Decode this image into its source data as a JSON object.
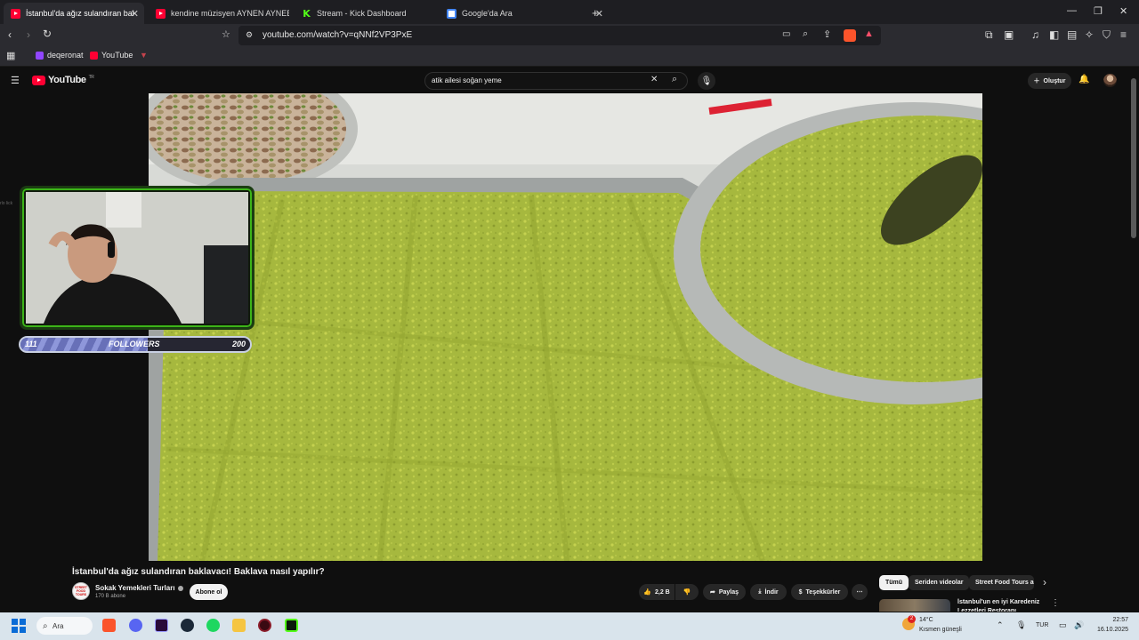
{
  "browser": {
    "tabs": [
      {
        "title": "İstanbul'da ağız sulandıran baklav",
        "favicon": "youtube-icon",
        "active": true
      },
      {
        "title": "kendine müzisyen AYNEN AYNEEEN",
        "favicon": "youtube-icon",
        "active": false
      },
      {
        "title": "Stream - Kick Dashboard",
        "favicon": "kick-icon",
        "active": false
      },
      {
        "title": "Google'da Ara",
        "favicon": "google-icon",
        "active": false
      }
    ],
    "new_tab": "+",
    "url": "youtube.com/watch?v=qNNf2VP3PxE",
    "bookmarks": [
      {
        "label": "deqeronat",
        "icon": "twitch-icon"
      },
      {
        "label": "YouTube",
        "icon": "youtube-icon"
      }
    ]
  },
  "youtube": {
    "logo": "YouTube",
    "logo_region": "TR",
    "search_query": "atik ailesi soğan yeme",
    "create_label": "Oluştur",
    "video": {
      "title": "İstanbul'da ağız sulandıran baklavacı! Baklava nasıl yapılır?",
      "channel_name": "Sokak Yemekleri Turları",
      "channel_avatar_text": "STREET FOOD TOURS",
      "subscribers": "170 B abone",
      "subscribe_label": "Abone ol",
      "likes": "2,2 B",
      "share_label": "Paylaş",
      "download_label": "İndir",
      "thanks_label": "Teşekkürler",
      "more": "⋯"
    },
    "chips": [
      "Tümü",
      "Seriden videolar",
      "Street Food Tours ad"
    ],
    "recommendation": {
      "title": "İstanbul'un en iyi Karedeniz Lezzetleri Restoranı"
    },
    "sidebar_fragment": "rlo lick"
  },
  "overlay": {
    "followers_label": "FOLLOWERS",
    "followers_current": "111",
    "followers_goal": "200",
    "followers_progress": 0.555
  },
  "taskbar": {
    "search_label": "Ara",
    "apps": [
      "brave-icon",
      "discord-icon",
      "premiere-icon",
      "steam-icon",
      "spotify-icon",
      "file-explorer-icon",
      "obs-icon",
      "kick-app-icon"
    ],
    "weather_badge": "2",
    "weather_temp": "14°C",
    "weather_desc": "Kısmen güneşli",
    "language": "TUR",
    "time": "22:57",
    "date": "16.10.2025"
  },
  "colors": {
    "youtube_red": "#ff0033",
    "kick_green": "#53fc18",
    "overlay_green": "#3cb418",
    "followers_bar": "#6870b8"
  }
}
